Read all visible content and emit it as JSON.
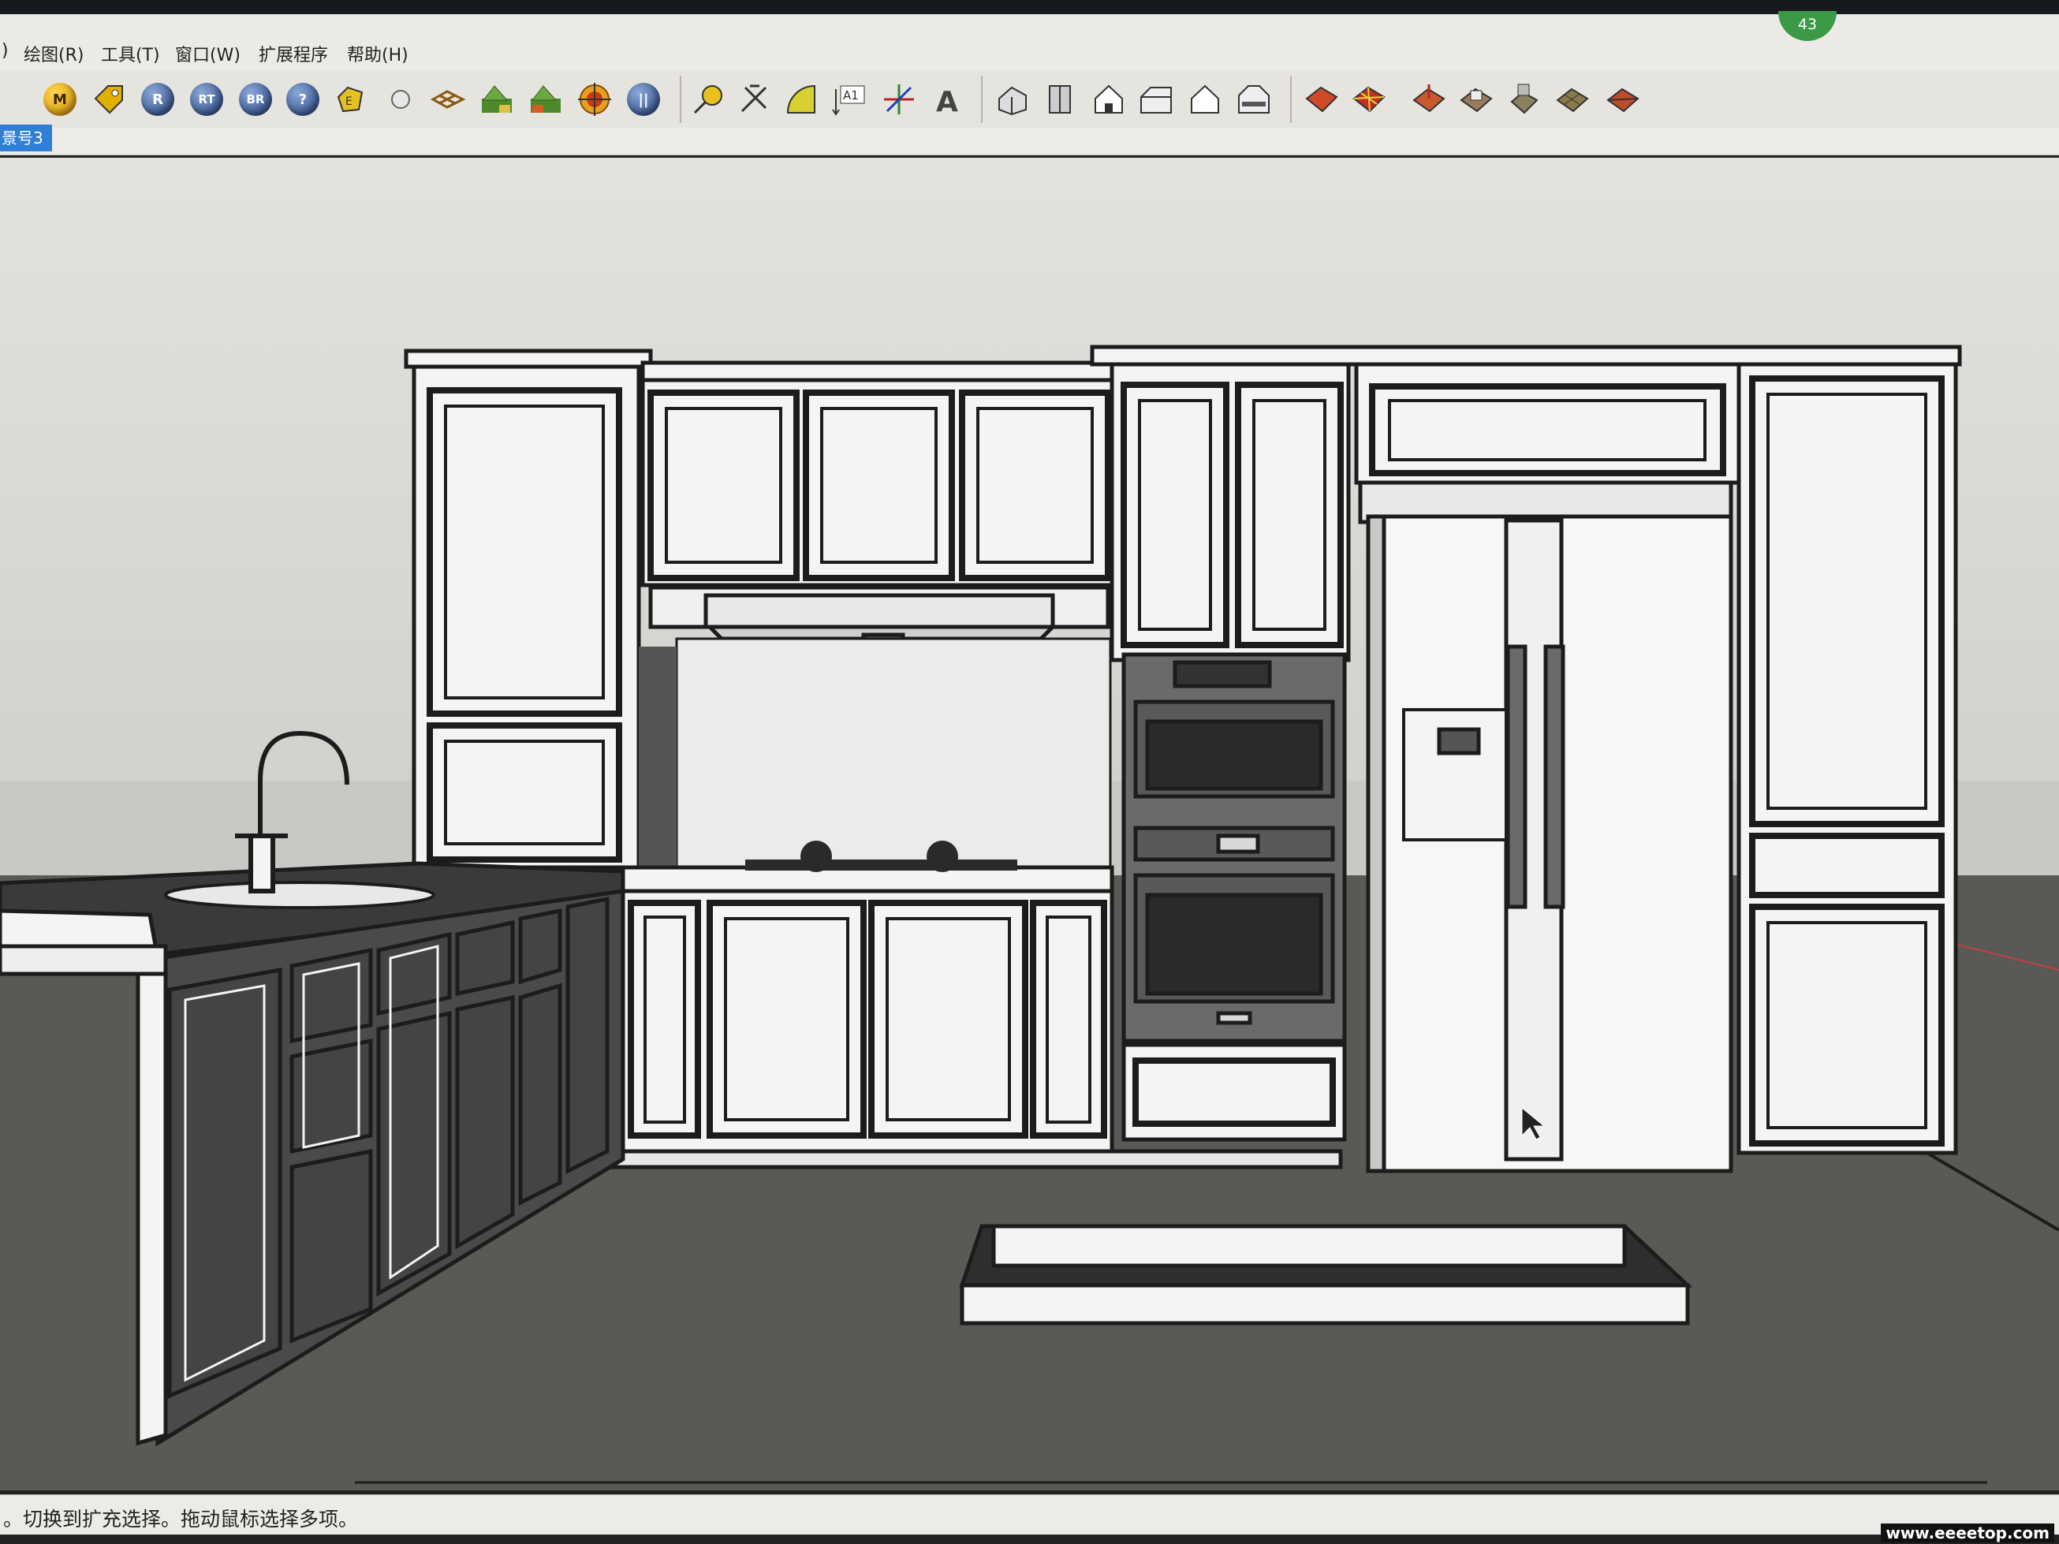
{
  "menu": {
    "items": [
      {
        "label": ")"
      },
      {
        "label": "绘图(R)"
      },
      {
        "label": "工具(T)"
      },
      {
        "label": "窗口(W)"
      },
      {
        "label": "扩展程序"
      },
      {
        "label": "帮助(H)"
      }
    ]
  },
  "notification_badge": "43",
  "toolbar": {
    "plugin_buttons": [
      {
        "icon": "m-ball-icon",
        "letter": "M"
      },
      {
        "icon": "tag-icon",
        "letter": ""
      },
      {
        "icon": "r-ball-icon",
        "letter": "R"
      },
      {
        "icon": "rt-ball-icon",
        "letter": "RT"
      },
      {
        "icon": "br-ball-icon",
        "letter": "BR"
      },
      {
        "icon": "help-ball-icon",
        "letter": "?"
      },
      {
        "icon": "label-tag-icon",
        "letter": ""
      },
      {
        "icon": "sphere-icon",
        "letter": ""
      },
      {
        "icon": "grid-icon",
        "letter": ""
      },
      {
        "icon": "landscape-icon",
        "letter": ""
      },
      {
        "icon": "landscape-edit-icon",
        "letter": ""
      },
      {
        "icon": "target-icon",
        "letter": ""
      },
      {
        "icon": "pause-icon",
        "letter": ""
      }
    ],
    "construction_tools": [
      {
        "icon": "tape-measure-icon",
        "label": ""
      },
      {
        "icon": "dimension-icon",
        "label": ""
      },
      {
        "icon": "protractor-icon",
        "label": ""
      },
      {
        "icon": "text-tool-icon",
        "label": "A1"
      },
      {
        "icon": "axes-icon",
        "label": ""
      },
      {
        "icon": "3d-text-icon",
        "label": "A"
      }
    ],
    "view_tools": [
      {
        "icon": "iso-view-icon"
      },
      {
        "icon": "top-view-icon"
      },
      {
        "icon": "front-view-icon"
      },
      {
        "icon": "right-view-icon"
      },
      {
        "icon": "back-view-icon"
      },
      {
        "icon": "left-view-icon"
      }
    ],
    "sandbox_tools": [
      {
        "icon": "sandbox-contours-icon"
      },
      {
        "icon": "sandbox-scratch-icon"
      },
      {
        "icon": "smoove-icon"
      },
      {
        "icon": "stamp-icon"
      },
      {
        "icon": "drape-icon"
      },
      {
        "icon": "add-detail-icon"
      },
      {
        "icon": "flip-edge-icon"
      }
    ]
  },
  "scene_tab": "景号3",
  "status_bar": {
    "text": "。切换到扩充选择。拖动鼠标选择多项。"
  },
  "watermark": "www.eeeetop.com",
  "colors": {
    "sky": "#dcdbd7",
    "horizon": "#c7c6c2",
    "ground": "#575652",
    "cabinet_face": "#f4f4f2",
    "outline": "#1c1c1c",
    "appliance": "#67676a",
    "scene_tab": "#2f7fd6",
    "badge": "#3a9a45"
  }
}
